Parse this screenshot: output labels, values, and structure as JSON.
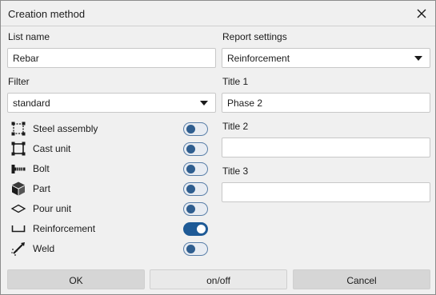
{
  "window": {
    "title": "Creation method"
  },
  "left": {
    "list_name_label": "List name",
    "list_name_value": "Rebar",
    "filter_label": "Filter",
    "filter_value": "standard",
    "filters": [
      {
        "label": "Steel assembly",
        "icon": "steel-assembly-icon",
        "on": false
      },
      {
        "label": "Cast unit",
        "icon": "cast-unit-icon",
        "on": false
      },
      {
        "label": "Bolt",
        "icon": "bolt-icon",
        "on": false
      },
      {
        "label": "Part",
        "icon": "part-icon",
        "on": false
      },
      {
        "label": "Pour unit",
        "icon": "pour-unit-icon",
        "on": false
      },
      {
        "label": "Reinforcement",
        "icon": "reinforcement-icon",
        "on": true
      },
      {
        "label": "Weld",
        "icon": "weld-icon",
        "on": false
      }
    ]
  },
  "right": {
    "report_settings_label": "Report settings",
    "report_settings_value": "Reinforcement",
    "title1_label": "Title 1",
    "title1_value": "Phase 2",
    "title2_label": "Title 2",
    "title2_value": "",
    "title3_label": "Title 3",
    "title3_value": ""
  },
  "footer": {
    "ok_label": "OK",
    "onoff_label": "on/off",
    "cancel_label": "Cancel"
  },
  "colors": {
    "toggle_on": "#1e5a96",
    "toggle_off_knob": "#2f5e8f",
    "dialog_bg": "#f0f0f0"
  }
}
